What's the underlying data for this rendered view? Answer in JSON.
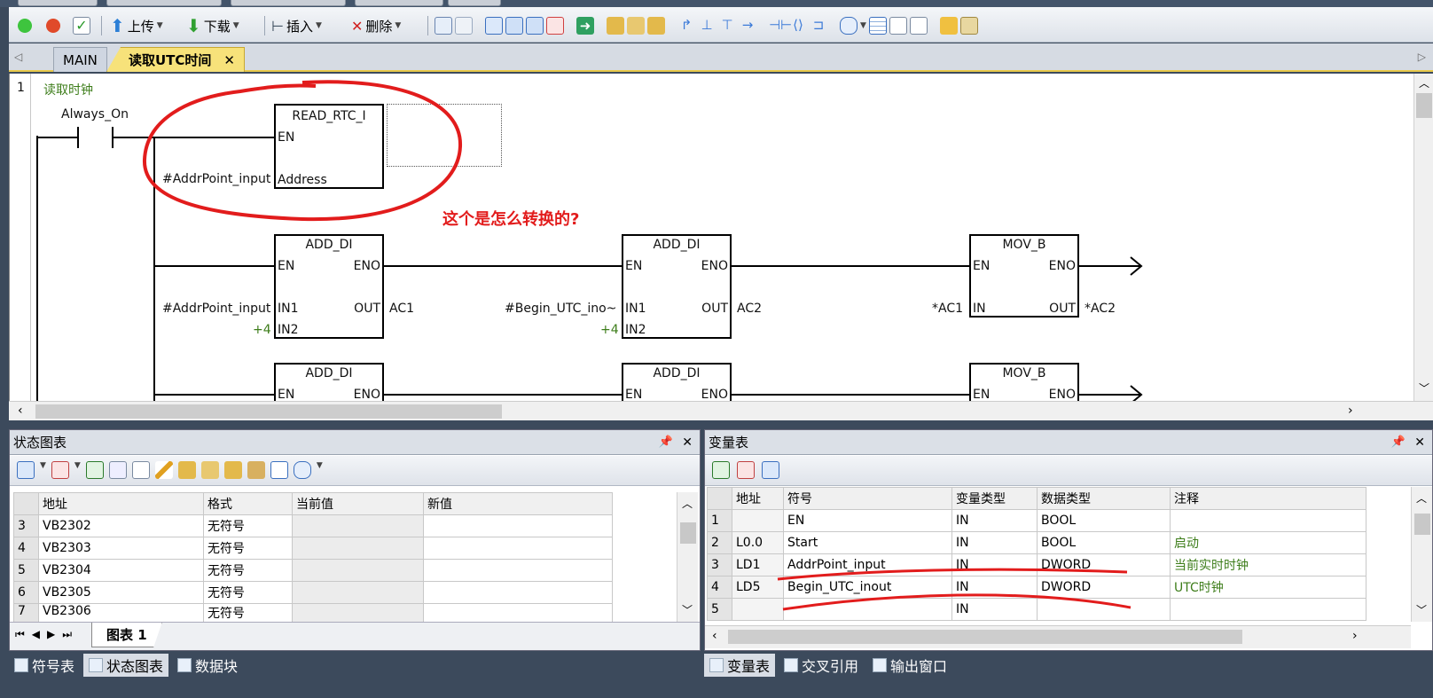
{
  "toolbar": {
    "upload_label": "上传",
    "download_label": "下载",
    "insert_label": "插入",
    "delete_label": "删除"
  },
  "tabs": {
    "main": "MAIN",
    "active": "读取UTC时间"
  },
  "editor": {
    "network_number": "1",
    "network_title": "读取时钟",
    "contact_label": "Always_On",
    "annotation": "这个是怎么转换的?",
    "blocks": {
      "read_rtc": {
        "name": "READ_RTC_I",
        "en": "EN",
        "address": "Address",
        "input": "#AddrPoint_input"
      },
      "add1": {
        "name": "ADD_DI",
        "en": "EN",
        "eno": "ENO",
        "in1": "IN1",
        "in2": "IN2",
        "out": "OUT",
        "in1_val": "#AddrPoint_input",
        "in2_val": "+4",
        "out_val": "AC1"
      },
      "add2": {
        "name": "ADD_DI",
        "en": "EN",
        "eno": "ENO",
        "in1": "IN1",
        "in2": "IN2",
        "out": "OUT",
        "in1_val": "#Begin_UTC_ino~",
        "in2_val": "+4",
        "out_val": "AC2"
      },
      "mov1": {
        "name": "MOV_B",
        "en": "EN",
        "eno": "ENO",
        "in": "IN",
        "out": "OUT",
        "in_val": "*AC1",
        "out_val": "*AC2"
      },
      "add3": {
        "name": "ADD_DI",
        "en": "EN",
        "eno": "ENO"
      },
      "add4": {
        "name": "ADD_DI",
        "en": "EN",
        "eno": "ENO"
      },
      "mov2": {
        "name": "MOV_B",
        "en": "EN",
        "eno": "ENO"
      }
    }
  },
  "status_panel": {
    "title": "状态图表",
    "columns": [
      "地址",
      "格式",
      "当前值",
      "新值"
    ],
    "rows": [
      {
        "n": "3",
        "addr": "VB2302",
        "fmt": "无符号"
      },
      {
        "n": "4",
        "addr": "VB2303",
        "fmt": "无符号"
      },
      {
        "n": "5",
        "addr": "VB2304",
        "fmt": "无符号"
      },
      {
        "n": "6",
        "addr": "VB2305",
        "fmt": "无符号"
      },
      {
        "n": "7",
        "addr": "VB2306",
        "fmt": "无符号"
      }
    ],
    "sheet_tab": "图表 1"
  },
  "var_panel": {
    "title": "变量表",
    "columns": [
      "地址",
      "符号",
      "变量类型",
      "数据类型",
      "注释"
    ],
    "rows": [
      {
        "n": "1",
        "addr": "",
        "sym": "EN",
        "vtype": "IN",
        "dtype": "BOOL",
        "note": ""
      },
      {
        "n": "2",
        "addr": "L0.0",
        "sym": "Start",
        "vtype": "IN",
        "dtype": "BOOL",
        "note": "启动"
      },
      {
        "n": "3",
        "addr": "LD1",
        "sym": "AddrPoint_input",
        "vtype": "IN",
        "dtype": "DWORD",
        "note": "当前实时时钟"
      },
      {
        "n": "4",
        "addr": "LD5",
        "sym": "Begin_UTC_inout",
        "vtype": "IN",
        "dtype": "DWORD",
        "note": "UTC时钟"
      },
      {
        "n": "5",
        "addr": "",
        "sym": "",
        "vtype": "IN",
        "dtype": "",
        "note": ""
      }
    ]
  },
  "bottom_left_tabs": [
    "符号表",
    "状态图表",
    "数据块"
  ],
  "bottom_right_tabs": [
    "变量表",
    "交叉引用",
    "输出窗口"
  ],
  "pin_close": {
    "pin": "ᵖ",
    "close": "✕"
  }
}
